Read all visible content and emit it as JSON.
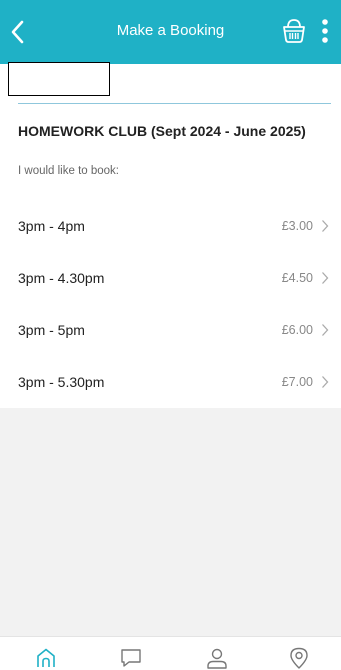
{
  "header": {
    "title": "Make a Booking",
    "back_icon": "chevron-left-icon",
    "basket_icon": "basket-icon",
    "more_icon": "more-vertical-icon",
    "color": "#1fb1c6"
  },
  "booking": {
    "club_title": "HOMEWORK CLUB (Sept 2024 - June 2025)",
    "prompt": "I would like to book:"
  },
  "options": [
    {
      "label": "3pm - 4pm",
      "price": "£3.00"
    },
    {
      "label": "3pm - 4.30pm",
      "price": "£4.50"
    },
    {
      "label": "3pm - 5pm",
      "price": "£6.00"
    },
    {
      "label": "3pm - 5.30pm",
      "price": "£7.00"
    }
  ],
  "tabbar": {
    "tabs": [
      {
        "icon": "home-icon",
        "active": true
      },
      {
        "icon": "chat-icon",
        "active": false
      },
      {
        "icon": "profile-icon",
        "active": false
      },
      {
        "icon": "location-pin-icon",
        "active": false
      }
    ],
    "active_color": "#1fb1c6",
    "inactive_color": "#777777"
  }
}
